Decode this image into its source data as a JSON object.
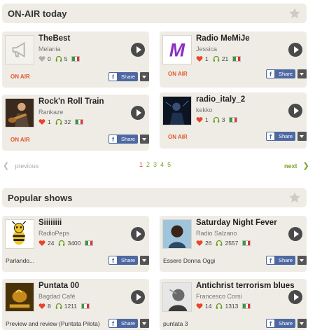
{
  "sections": {
    "onair": {
      "title": "ON-AIR today"
    },
    "popular": {
      "title": "Popular shows"
    }
  },
  "onair_cards": [
    {
      "name": "TheBest",
      "user": "Melania",
      "likes": "0",
      "listens": "5",
      "liked": false,
      "status": "ON AIR",
      "share": "Share"
    },
    {
      "name": "Radio MeMiJe",
      "user": "Jessica",
      "likes": "1",
      "listens": "21",
      "liked": true,
      "status": "ON AIR",
      "share": "Share"
    },
    {
      "name": "Rock'n Roll Train",
      "user": "Rankaze",
      "likes": "1",
      "listens": "32",
      "liked": true,
      "status": "ON AIR",
      "share": "Share"
    },
    {
      "name": "radio_italy_2",
      "user": "kekko",
      "likes": "1",
      "listens": "3",
      "liked": true,
      "status": "ON AIR",
      "share": "Share"
    }
  ],
  "pager": {
    "previous": "previous",
    "pages": [
      "1",
      "2",
      "3",
      "4",
      "5"
    ],
    "current": "1",
    "next": "next"
  },
  "popular_cards": [
    {
      "name": "Siiiiiiii",
      "user": "RadioPeps",
      "likes": "24",
      "listens": "3400",
      "liked": true,
      "desc": "Parlando...",
      "share": "Share"
    },
    {
      "name": "Saturday Night Fever",
      "user": "Radio Salzano",
      "likes": "26",
      "listens": "2557",
      "liked": true,
      "desc": "Essere Donna Oggi",
      "share": "Share"
    },
    {
      "name": "Puntata 00",
      "user": "Bagdad Café",
      "likes": "8",
      "listens": "1211",
      "liked": true,
      "desc": "Preview and review (Puntata Pilota)",
      "share": "Share"
    },
    {
      "name": "Antichrist terrorism blues",
      "user": "Francesco Corsi",
      "likes": "14",
      "listens": "1313",
      "liked": true,
      "desc": "puntata 3",
      "share": "Share"
    }
  ],
  "colors": {
    "accent_orange": "#e05a2b",
    "accent_green": "#7aa325",
    "heart_red": "#e8452c",
    "facebook_blue": "#4e69a2",
    "card_bg": "#efece6"
  },
  "icons": {
    "star": "star-icon",
    "play": "play-icon",
    "heart": "heart-icon",
    "headphones": "headphones-icon",
    "flag": "italy-flag-icon",
    "facebook": "facebook-icon",
    "dropdown": "chevron-down-icon"
  }
}
